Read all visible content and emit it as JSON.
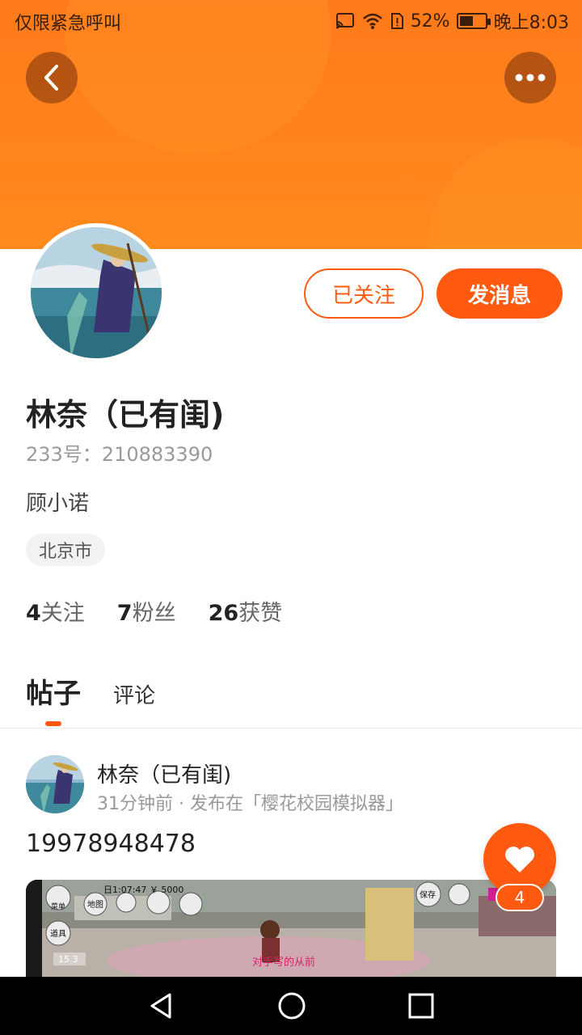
{
  "status_bar": {
    "carrier": "仅限紧急呼叫",
    "battery": "52%",
    "battery_level": 0.52,
    "time": "晚上8:03"
  },
  "profile": {
    "follow_state_label": "已关注",
    "message_label": "发消息",
    "name": "林奈（已有闺)",
    "uid": "233号：210883390",
    "bio": "顾小诺",
    "location": "北京市",
    "stats": [
      {
        "count": "4",
        "label": "关注"
      },
      {
        "count": "7",
        "label": "粉丝"
      },
      {
        "count": "26",
        "label": "获赞"
      }
    ]
  },
  "tabs": {
    "posts": "帖子",
    "comments": "评论"
  },
  "post": {
    "author": "林奈（已有闺)",
    "meta": "31分钟前 · 发布在「樱花校园模拟器」",
    "text": "19978948478",
    "likes": "4",
    "game_hud": {
      "time_money": "日1:07:47 ￥ 5000",
      "menu": "菜单",
      "map": "地图",
      "items": "道具",
      "save": "保存",
      "level": "15.3",
      "caption": "对手写的从前"
    }
  },
  "colors": {
    "accent": "#ff5a10",
    "header": "#ff7a1c"
  }
}
